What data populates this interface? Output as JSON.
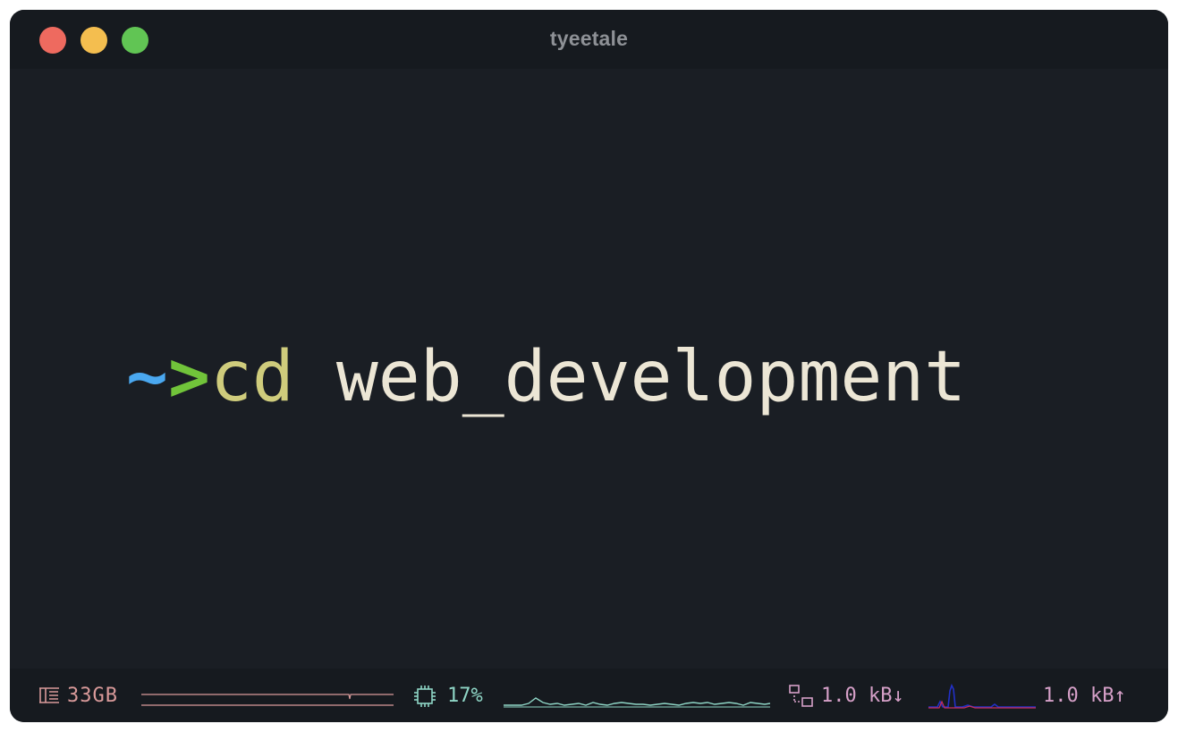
{
  "window": {
    "title": "tyeetale"
  },
  "terminal": {
    "prompt_tilde": "~",
    "prompt_arrow": ">",
    "command": "cd",
    "argument": "web_development"
  },
  "statusbar": {
    "memory": {
      "icon": "memory-icon",
      "value": "33GB"
    },
    "cpu": {
      "icon": "cpu-chip-icon",
      "value": "17%"
    },
    "network": {
      "icon": "network-icon",
      "download": "1.0 kB↓",
      "upload": "1.0 kB↑"
    }
  },
  "colors": {
    "background": "#1a1e24",
    "titlebar": "#161a1f",
    "close": "#ee6a5f",
    "minimize": "#f4be4f",
    "maximize": "#61c554",
    "tilde": "#4aa8f0",
    "arrow": "#71c43a",
    "command": "#cfcc7c",
    "argument": "#ece6d5",
    "memory": "#d99a9a",
    "cpu": "#8fd6c6",
    "network": "#d6a0c8"
  }
}
